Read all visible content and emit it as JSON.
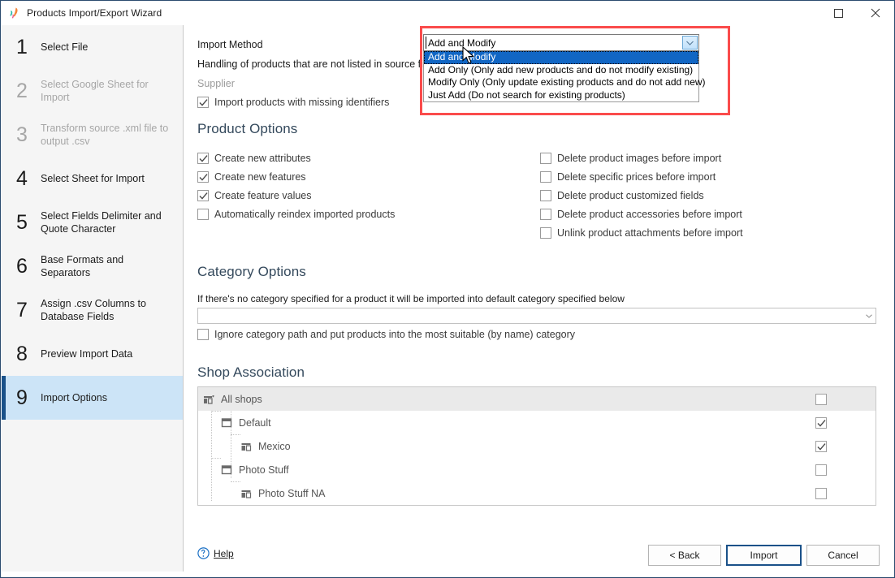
{
  "window": {
    "title": "Products Import/Export Wizard",
    "app_icon": "feather-icon",
    "maximize_label": "Maximize",
    "close_label": "Close"
  },
  "sidebar": {
    "items": [
      {
        "num": "1",
        "label": "Select File",
        "state": "enabled"
      },
      {
        "num": "2",
        "label": "Select Google Sheet for Import",
        "state": "disabled"
      },
      {
        "num": "3",
        "label": "Transform source .xml file to output .csv",
        "state": "disabled"
      },
      {
        "num": "4",
        "label": "Select Sheet for Import",
        "state": "enabled"
      },
      {
        "num": "5",
        "label": "Select Fields Delimiter and Quote Character",
        "state": "enabled"
      },
      {
        "num": "6",
        "label": "Base Formats and Separators",
        "state": "enabled"
      },
      {
        "num": "7",
        "label": "Assign .csv Columns to Database Fields",
        "state": "enabled"
      },
      {
        "num": "8",
        "label": "Preview Import Data",
        "state": "enabled"
      },
      {
        "num": "9",
        "label": "Import Options",
        "state": "active"
      }
    ]
  },
  "main": {
    "import_method_label": "Import Method",
    "handling_label": "Handling of products that are not listed in source file",
    "supplier_label": "Supplier",
    "missing_identifiers": {
      "label": "Import products with missing identifiers",
      "checked": true
    },
    "import_method_dropdown": {
      "selected": "Add and Modify",
      "expanded": true,
      "highlight_color": "#fa4b4b",
      "options": [
        {
          "label": "Add and Modify",
          "selected": true
        },
        {
          "label": "Add Only (Only add new products and do not modify existing)",
          "selected": false
        },
        {
          "label": "Modify Only (Only update existing products and do not add new)",
          "selected": false
        },
        {
          "label": "Just Add (Do not search for existing products)",
          "selected": false
        }
      ]
    },
    "product_options": {
      "heading": "Product Options",
      "left": [
        {
          "label": "Create new attributes",
          "checked": true
        },
        {
          "label": "Create new features",
          "checked": true
        },
        {
          "label": "Create feature values",
          "checked": true
        },
        {
          "label": "Automatically reindex imported products",
          "checked": false
        }
      ],
      "right": [
        {
          "label": "Delete product images before import",
          "checked": false
        },
        {
          "label": "Delete specific prices before import",
          "checked": false
        },
        {
          "label": "Delete product customized fields",
          "checked": false
        },
        {
          "label": "Delete product accessories before import",
          "checked": false
        },
        {
          "label": "Unlink product attachments before import",
          "checked": false
        }
      ]
    },
    "category_options": {
      "heading": "Category Options",
      "description": "If there's no category specified for a product it will be imported into default category specified below",
      "default_category_value": "",
      "default_category_placeholder": "",
      "ignore_path": {
        "label": "Ignore category path and put products into the most suitable (by name) category",
        "checked": false
      }
    },
    "shop_association": {
      "heading": "Shop Association",
      "rows": [
        {
          "label": "All shops",
          "icon": "shops-group-icon",
          "depth": 0,
          "checked": false,
          "selected": true
        },
        {
          "label": "Default",
          "icon": "shop-icon",
          "depth": 1,
          "checked": true,
          "selected": false
        },
        {
          "label": "Mexico",
          "icon": "shops-group-icon",
          "depth": 2,
          "checked": true,
          "selected": false
        },
        {
          "label": "Photo Stuff",
          "icon": "shop-icon",
          "depth": 1,
          "checked": false,
          "selected": false
        },
        {
          "label": "Photo Stuff NA",
          "icon": "shops-group-icon",
          "depth": 2,
          "checked": false,
          "selected": false
        }
      ]
    }
  },
  "footer": {
    "help_label": "Help",
    "help_icon": "question-circle-icon",
    "back_label": "< Back",
    "back_accel": "B",
    "import_label": "Import",
    "import_accel": "I",
    "cancel_label": "Cancel",
    "cancel_accel": "C",
    "default_button": "import"
  },
  "colors": {
    "accent": "#1a5189",
    "active_row": "#cce4f7",
    "highlight": "#fa4b4b",
    "selection": "#1166c4"
  }
}
